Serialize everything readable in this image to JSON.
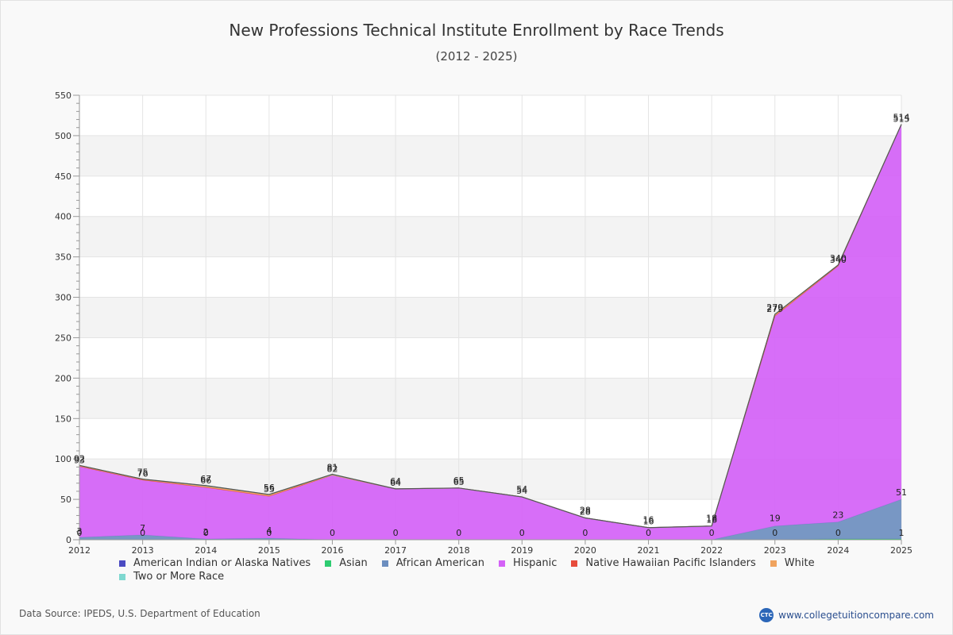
{
  "chart_data": {
    "type": "area",
    "title": "New Professions Technical Institute Enrollment by Race Trends",
    "subtitle": "(2012 - 2025)",
    "x": [
      "2012",
      "2013",
      "2014",
      "2015",
      "2016",
      "2017",
      "2018",
      "2019",
      "2020",
      "2021",
      "2022",
      "2023",
      "2024",
      "2025"
    ],
    "ylim": [
      0,
      550
    ],
    "yticks": [
      0,
      50,
      100,
      150,
      200,
      250,
      300,
      350,
      400,
      450,
      500,
      550
    ],
    "stacked": true,
    "grid": true,
    "legend_position": "bottom",
    "series": [
      {
        "name": "American Indian or Alaska Natives",
        "color": "#4b4bc2",
        "values": [
          0,
          0,
          0,
          0,
          0,
          0,
          0,
          0,
          0,
          0,
          0,
          0,
          1,
          1
        ]
      },
      {
        "name": "Asian",
        "color": "#2ecc71",
        "values": [
          0,
          0,
          0,
          0,
          0,
          0,
          0,
          0,
          0,
          0,
          0,
          0,
          0,
          0
        ]
      },
      {
        "name": "African American",
        "color": "#6c8ebf",
        "values": [
          3,
          6,
          1,
          2,
          0,
          0,
          0,
          0,
          0,
          0,
          0,
          17,
          21,
          49
        ]
      },
      {
        "name": "Hispanic",
        "color": "#d462f7",
        "values": [
          88,
          68,
          64,
          52,
          80,
          63,
          64,
          53,
          27,
          15,
          17,
          260,
          317,
          464
        ]
      },
      {
        "name": "Native Hawaiian Pacific Islanders",
        "color": "#e74c3c",
        "values": [
          0,
          0,
          0,
          0,
          0,
          0,
          0,
          0,
          0,
          0,
          0,
          0,
          0,
          0
        ]
      },
      {
        "name": "White",
        "color": "#f0a35e",
        "values": [
          1,
          1,
          1,
          2,
          0,
          0,
          0,
          0,
          0,
          0,
          0,
          2,
          1,
          0
        ]
      },
      {
        "name": "Two or More Race",
        "color": "#7fd8d0",
        "values": [
          0,
          0,
          1,
          0,
          1,
          0,
          0,
          0,
          0,
          0,
          0,
          0,
          0,
          0
        ]
      }
    ],
    "totals": [
      92,
      75,
      67,
      56,
      81,
      64,
      65,
      54,
      28,
      16,
      18,
      279,
      340,
      514
    ],
    "total_labels_alt": [
      "93",
      "76",
      "66",
      "55",
      "82",
      "64",
      "65",
      "54",
      "28",
      "16",
      "18",
      "279",
      "340",
      "515"
    ],
    "bottom_labels": [
      "0",
      "0",
      "0",
      "0",
      "0",
      "0",
      "0",
      "0",
      "0",
      "0",
      "0",
      "0",
      "0",
      "1"
    ],
    "low_labels": [
      "3",
      "7",
      "2",
      "4",
      "",
      "",
      "",
      "",
      "",
      "",
      "",
      "19",
      "23",
      "51"
    ]
  },
  "footer": {
    "source": "Data Source: IPEDS, U.S. Department of Education",
    "brand_logo": "CTC",
    "brand_url": "www.collegetuitioncompare.com"
  }
}
